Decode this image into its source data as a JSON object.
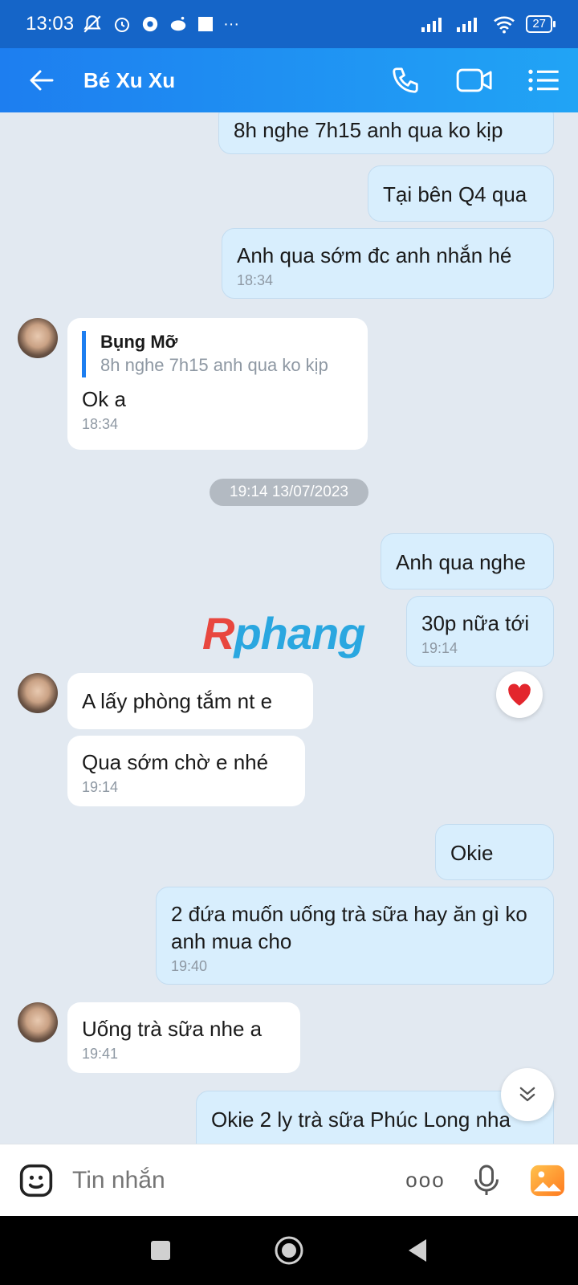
{
  "status_bar": {
    "time": "13:03",
    "more": "···",
    "battery": "27"
  },
  "header": {
    "title": "Bé Xu Xu"
  },
  "messages": {
    "m1": {
      "text": "8h nghe 7h15 anh qua ko kịp"
    },
    "m2": {
      "text": "Tại bên Q4 qua"
    },
    "m3": {
      "text": "Anh qua sớm đc anh nhắn hé",
      "time": "18:34"
    },
    "m4": {
      "quote_name": "Bụng Mỡ",
      "quote_text": "8h nghe 7h15 anh qua ko kịp",
      "text": "Ok a",
      "time": "18:34"
    },
    "date_divider": "19:14 13/07/2023",
    "m5": {
      "text": "Anh qua nghe"
    },
    "m6": {
      "text": "30p nữa tới",
      "time": "19:14"
    },
    "m7": {
      "text": "A lấy phòng tắm nt e"
    },
    "m8": {
      "text": "Qua sớm chờ e nhé",
      "time": "19:14"
    },
    "m9": {
      "text": "Okie"
    },
    "m10": {
      "text": "2 đứa muốn uống trà sữa hay ăn gì ko anh mua cho",
      "time": "19:40"
    },
    "m11": {
      "text": "Uống trà sữa nhe a",
      "time": "19:41"
    },
    "m12": {
      "text": "Okie 2 ly trà sữa Phúc Long nha"
    }
  },
  "watermark": {
    "first": "R",
    "rest": "phang"
  },
  "input": {
    "placeholder": "Tin nhắn",
    "more": "ooo"
  },
  "icons": {
    "back": "arrow-left-icon",
    "call": "phone-icon",
    "video": "video-camera-icon",
    "menu": "list-menu-icon",
    "emoji": "sticker-icon",
    "mic": "microphone-icon",
    "gallery": "image-icon",
    "reaction": "heart-icon",
    "scroll": "double-chevron-down-icon"
  },
  "colors": {
    "header_start": "#1d7ef0",
    "header_end": "#21a4f5",
    "outgoing_bubble": "#d8eefd",
    "accent": "#1d7ef0",
    "heart": "#e3262d"
  }
}
